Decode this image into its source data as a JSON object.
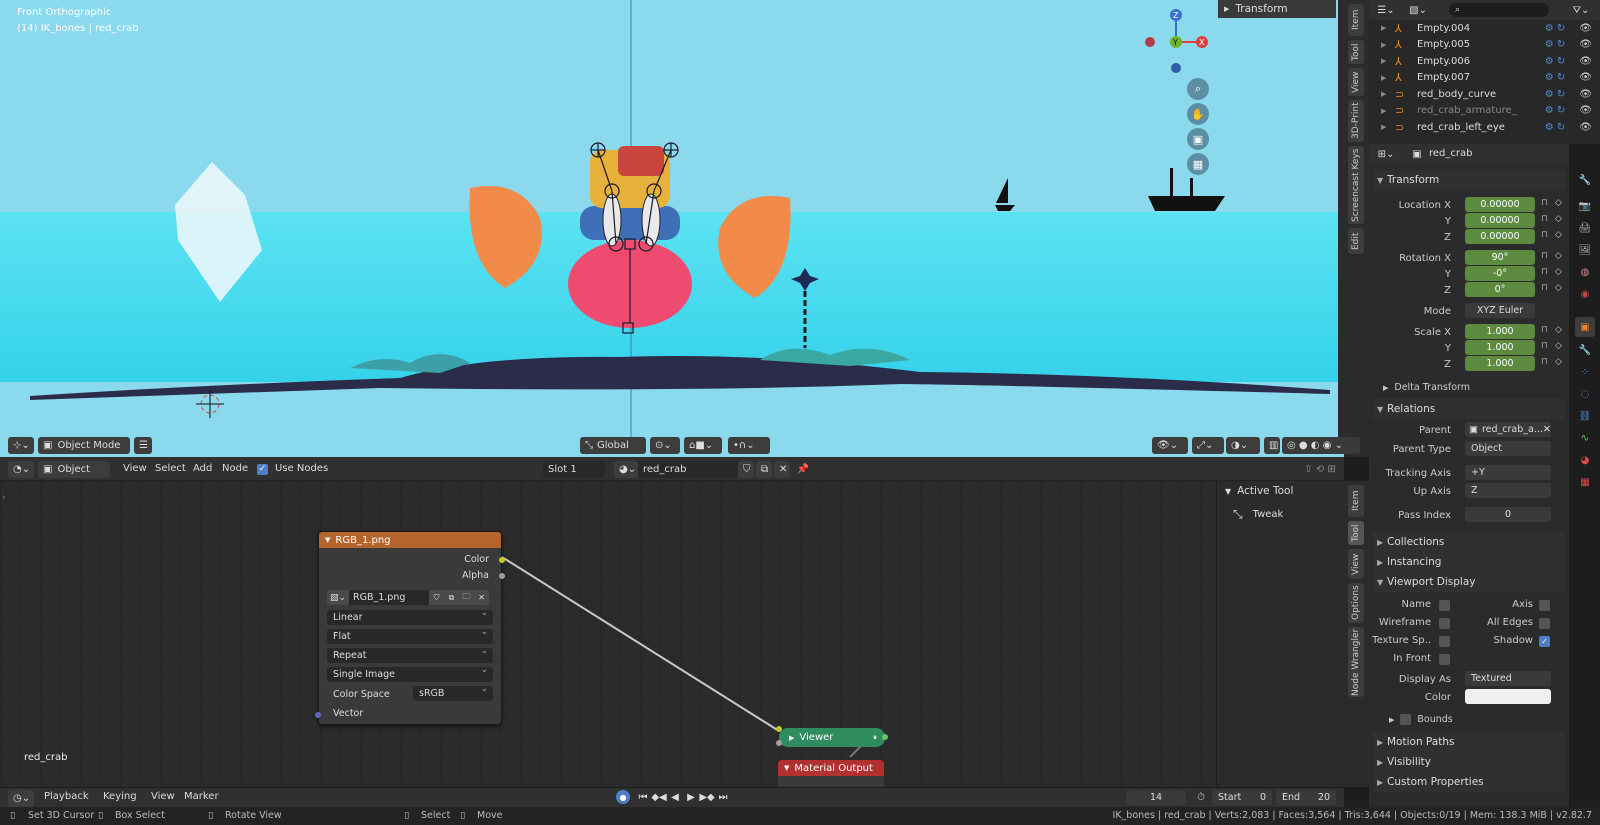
{
  "viewport": {
    "view_name": "Front Orthographic",
    "collection_info": "(14) IK_bones | red_crab",
    "transform_panel": "Transform",
    "side_tabs": [
      "Item",
      "Tool",
      "View",
      "3D-Print",
      "Screencast Keys",
      "Edit"
    ],
    "mode": "Object Mode",
    "orientation": "Global",
    "axis_labels": {
      "z": "Z",
      "y": "Y",
      "x": "X"
    }
  },
  "node_editor": {
    "header": {
      "type": "Object",
      "menus": [
        "View",
        "Select",
        "Add",
        "Node"
      ],
      "use_nodes_label": "Use Nodes",
      "slot": "Slot 1",
      "material": "red_crab"
    },
    "image_node": {
      "title": "RGB_1.png",
      "outputs": [
        "Color",
        "Alpha"
      ],
      "image_name": "RGB_1.png",
      "interpolation": "Linear",
      "projection": "Flat",
      "extension": "Repeat",
      "source": "Single Image",
      "color_space_label": "Color Space",
      "color_space": "sRGB",
      "input": "Vector"
    },
    "viewer_node": {
      "title": "Viewer"
    },
    "material_output_node": {
      "title": "Material Output"
    },
    "material_label": "red_crab",
    "npanel": {
      "section": "Active Tool",
      "tool": "Tweak",
      "tabs": [
        "Item",
        "Tool",
        "View",
        "Options",
        "Node Wrangler"
      ]
    }
  },
  "outliner": {
    "items": [
      {
        "name": "Empty.004",
        "type": "empty"
      },
      {
        "name": "Empty.005",
        "type": "empty"
      },
      {
        "name": "Empty.006",
        "type": "empty"
      },
      {
        "name": "Empty.007",
        "type": "empty"
      },
      {
        "name": "red_body_curve",
        "type": "curve"
      },
      {
        "name": "red_crab_armature_IK",
        "type": "armature"
      },
      {
        "name": "red_crab_left_eye",
        "type": "curve"
      }
    ]
  },
  "properties": {
    "object_name": "red_crab",
    "transform": {
      "title": "Transform",
      "location_label": "Location X",
      "loc": [
        "0.00000",
        "0.00000",
        "0.00000"
      ],
      "rotation_label": "Rotation X",
      "rot": [
        "90°",
        "-0°",
        "0°"
      ],
      "mode_label": "Mode",
      "mode": "XYZ Euler",
      "scale_label": "Scale X",
      "scale": [
        "1.000",
        "1.000",
        "1.000"
      ],
      "y_label": "Y",
      "z_label": "Z"
    },
    "delta_transform": "Delta Transform",
    "relations": {
      "title": "Relations",
      "parent_label": "Parent",
      "parent": "red_crab_a...",
      "parent_type_label": "Parent Type",
      "parent_type": "Object",
      "tracking_axis_label": "Tracking Axis",
      "tracking_axis": "+Y",
      "up_axis_label": "Up Axis",
      "up_axis": "Z",
      "pass_index_label": "Pass Index",
      "pass_index": "0"
    },
    "collections": "Collections",
    "instancing": "Instancing",
    "viewport_display": {
      "title": "Viewport Display",
      "name": "Name",
      "axis": "Axis",
      "wireframe": "Wireframe",
      "all_edges": "All Edges",
      "texture_space": "Texture Sp..",
      "shadow": "Shadow",
      "in_front": "In Front",
      "display_as_label": "Display As",
      "display_as": "Textured",
      "color_label": "Color",
      "bounds": "Bounds"
    },
    "motion_paths": "Motion Paths",
    "visibility": "Visibility",
    "custom_properties": "Custom Properties"
  },
  "timeline": {
    "menus": [
      "Playback",
      "Keying",
      "View",
      "Marker"
    ],
    "current_frame": "14",
    "start_label": "Start",
    "start": "0",
    "end_label": "End",
    "end": "20"
  },
  "status": {
    "hint1": "Set 3D Cursor",
    "hint2": "Box Select",
    "hint3": "Rotate View",
    "hint4": "Select",
    "hint5": "Move",
    "stats": "IK_bones | red_crab | Verts:2,083 | Faces:3,564 | Tris:3,644 | Objects:0/19 | Mem: 138.3 MiB | v2.82.7"
  },
  "colors": {
    "sky": "#8ad9ec",
    "sea": "#3ad6ec",
    "field_green": "#5c8a3f",
    "image_node_header": "#b5652b",
    "viewer_node": "#2f8c5e",
    "output_node_header": "#b23030"
  }
}
